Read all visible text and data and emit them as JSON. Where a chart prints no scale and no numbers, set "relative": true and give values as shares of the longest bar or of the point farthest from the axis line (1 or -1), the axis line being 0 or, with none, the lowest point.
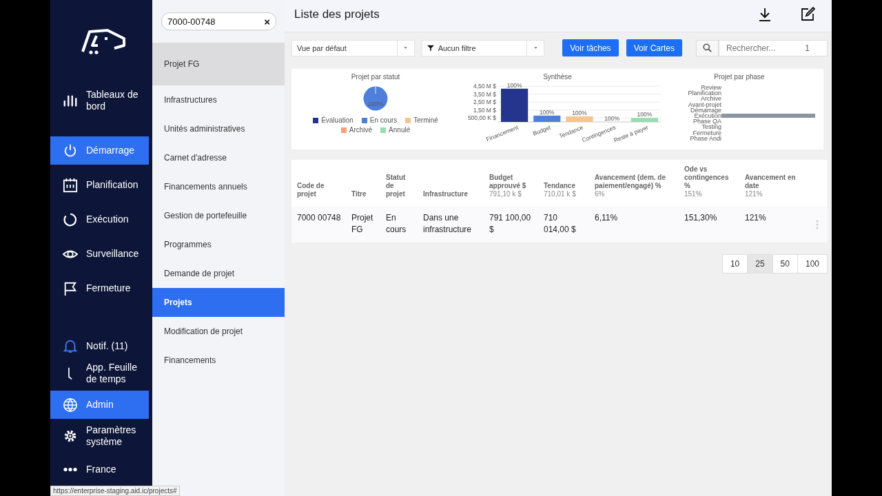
{
  "nav": {
    "items": [
      {
        "label": "Tableaux de bord",
        "selected": false
      },
      {
        "label": "Démarrage",
        "selected": true
      },
      {
        "label": "Planification",
        "selected": false
      },
      {
        "label": "Exécution",
        "selected": false
      },
      {
        "label": "Surveillance",
        "selected": false
      },
      {
        "label": "Fermeture",
        "selected": false
      },
      {
        "label": "Notif. (11)",
        "selected": false
      },
      {
        "label": "App. Feuille de temps",
        "selected": false
      },
      {
        "label": "Admin",
        "selected": true
      },
      {
        "label": "Paramètres système",
        "selected": false
      },
      {
        "label": "France",
        "selected": false
      }
    ]
  },
  "status_url": "https://enterprise-staging.aid.ic/projects#",
  "submenu": {
    "search": {
      "value": "7000-00748",
      "clear": "×"
    },
    "context": "Projet FG",
    "items": [
      {
        "label": "Infrastructures",
        "selected": false
      },
      {
        "label": "Unités administratives",
        "selected": false
      },
      {
        "label": "Carnet d'adresse",
        "selected": false
      },
      {
        "label": "Financements annuels",
        "selected": false
      },
      {
        "label": "Gestion de portefeuille",
        "selected": false
      },
      {
        "label": "Programmes",
        "selected": false
      },
      {
        "label": "Demande de projet",
        "selected": false
      },
      {
        "label": "Projets",
        "selected": true
      },
      {
        "label": "Modification de projet",
        "selected": false
      },
      {
        "label": "Financements",
        "selected": false
      }
    ]
  },
  "page": {
    "title": "Liste des projets"
  },
  "toolbar": {
    "view": {
      "value": "Vue par défaut"
    },
    "filter": {
      "value": "Aucun filtre"
    },
    "buttons": [
      "Voir tâches",
      "Voir Cartes"
    ],
    "search": {
      "placeholder": "Rechercher...",
      "count": "1"
    }
  },
  "charts": [
    {
      "chart_data": {
        "type": "pie",
        "title": "Projet par statut",
        "categories": [
          "Évaluation",
          "En cours",
          "Terminé",
          "Archivé",
          "Annulé"
        ],
        "series": [
          {
            "colors": [
              "#25348f",
              "#4f7fdc",
              "#f3c58f",
              "#f4a07a",
              "#97dcb0"
            ],
            "values": [
              0,
              1,
              0,
              0,
              0
            ]
          }
        ],
        "value_labels": [
          null,
          "100%",
          null,
          null,
          null
        ]
      }
    },
    {
      "chart_data": {
        "type": "bar",
        "title": "Synthèse",
        "categories": [
          "Financement",
          "Budget",
          "Tendance",
          "Contingences",
          "Reste à payer"
        ],
        "series": [
          {
            "colors": [
              "#25348f",
              "#4f7fdc",
              "#f3c58f",
              null,
              "#97dcb0"
            ],
            "values": [
              4200000,
              800000,
              700000,
              0,
              500000
            ]
          }
        ],
        "ylim": [
          0,
          4700000
        ],
        "yticks": [
          {
            "value": 500000,
            "label": "500,00 K $"
          },
          {
            "value": 1500000,
            "label": "1,50 M $"
          },
          {
            "value": 2500000,
            "label": "2,50 M $"
          },
          {
            "value": 3500000,
            "label": "3,50 M $"
          },
          {
            "value": 4500000,
            "label": "4,50 M $"
          }
        ],
        "grid": true,
        "value_labels": [
          "100%",
          "100%",
          "100%",
          "100%",
          "100%"
        ]
      }
    },
    {
      "chart_data": {
        "type": "bar",
        "orientation": "horizontal",
        "title": "Projet par phase",
        "categories": [
          "Review",
          "Planification",
          "Archive",
          "Avant-projet",
          "Démarrage",
          "Exécution",
          "Phase QA",
          "Testing",
          "Fermeture",
          "Phase Andi"
        ],
        "series": [
          {
            "color": "#8c96a3",
            "values": [
              0,
              0,
              0,
              0,
              0,
              1,
              0,
              0,
              0,
              0
            ]
          }
        ],
        "relative": true
      }
    }
  ],
  "table": {
    "columns": [
      {
        "label": "Code de projet"
      },
      {
        "label": "Titre"
      },
      {
        "label": "Statut de projet"
      },
      {
        "label": "Infrastructure"
      },
      {
        "label": "Budget approuvé $",
        "summary": "791,10 k $"
      },
      {
        "label": "Tendance",
        "summary": "710,01 k $"
      },
      {
        "label": "Avancement (dem. de paiement/engagé) %",
        "summary": "6%"
      },
      {
        "label": "Ode vs contingences %",
        "summary": "151%"
      },
      {
        "label": "Avancement en date",
        "summary": "121%"
      }
    ],
    "rows": [
      {
        "cells": [
          "7000 00748",
          "Projet FG",
          "En cours",
          "Dans une infrastructure",
          "791 100,00 $",
          "710 014,00 $",
          "6,11%",
          "151,30%",
          "121%"
        ]
      }
    ]
  },
  "pagination": [
    {
      "label": "10",
      "selected": false
    },
    {
      "label": "25",
      "selected": true
    },
    {
      "label": "50",
      "selected": false
    },
    {
      "label": "100",
      "selected": false
    }
  ]
}
